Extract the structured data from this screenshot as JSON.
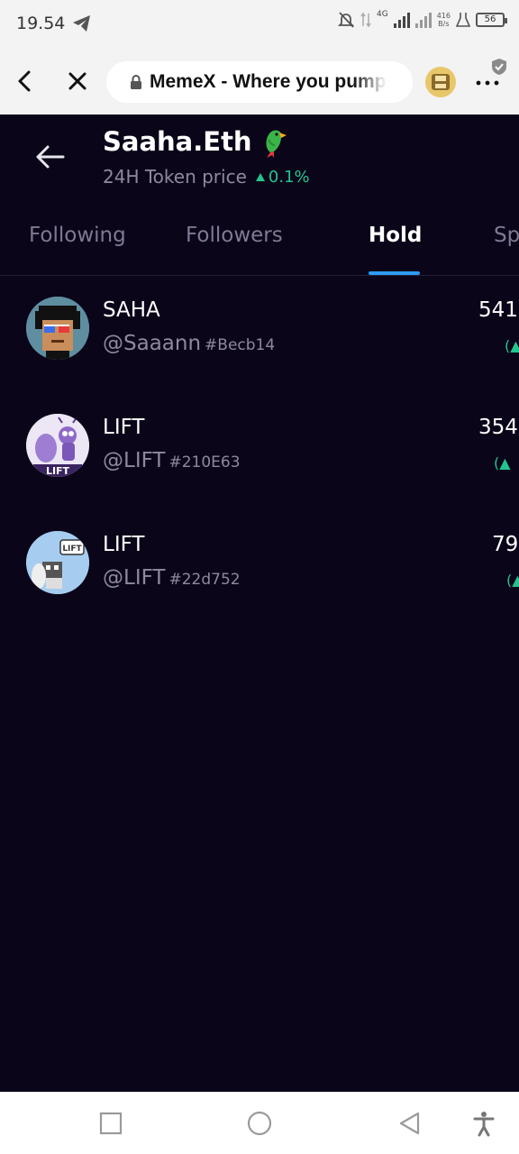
{
  "status_bar": {
    "time": "19.54",
    "net_type": "4G",
    "net_speed_value": "416",
    "net_speed_unit": "B/s",
    "battery": "56"
  },
  "browser": {
    "url_text": "MemeX - Where you pump"
  },
  "profile": {
    "name": "Saaha.Eth",
    "price_label": "24H Token price",
    "price_change": "0.1%"
  },
  "tabs": [
    {
      "label": "Following"
    },
    {
      "label": "Followers"
    },
    {
      "label": "Hold"
    },
    {
      "label": "Sp"
    }
  ],
  "active_tab": "Hold",
  "holders": [
    {
      "name": "SAHA",
      "handle": "@Saaann",
      "tag": "#Becb14",
      "amount": "541",
      "change": "(▲"
    },
    {
      "name": "LIFT",
      "handle": "@LIFT",
      "tag": "#210E63",
      "amount": "354",
      "change": "(▲"
    },
    {
      "name": "LIFT",
      "handle": "@LIFT",
      "tag": "#22d752",
      "amount": "79",
      "change": "(▲"
    }
  ],
  "colors": {
    "background": "#0b0519",
    "accent": "#2c9bf0",
    "positive": "#25c48f",
    "muted_text": "#8d8aa0"
  },
  "icons": [
    "telegram-icon",
    "mute-icon",
    "signal-icon",
    "battery-icon",
    "back-icon",
    "close-icon",
    "lock-icon",
    "site-favicon-icon",
    "more-icon",
    "shield-icon",
    "arrow-left-icon",
    "parrot-icon",
    "square-icon",
    "circle-icon",
    "triangle-back-icon",
    "accessibility-icon"
  ]
}
